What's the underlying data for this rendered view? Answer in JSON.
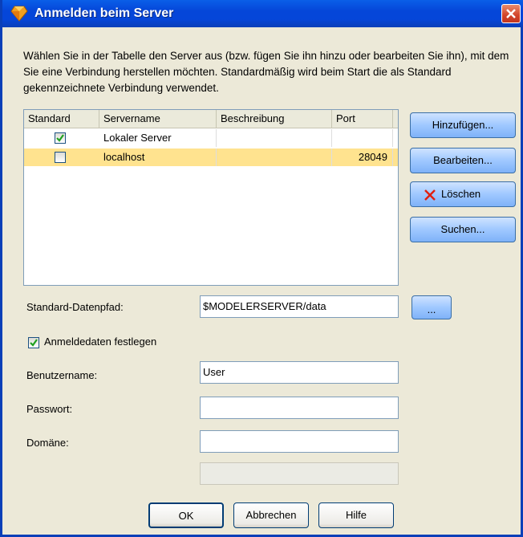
{
  "window": {
    "title": "Anmelden beim Server",
    "close_icon": "close-icon",
    "app_icon": "diamond-logo-icon"
  },
  "description": "Wählen Sie in der Tabelle den Server aus (bzw. fügen Sie ihn hinzu oder bearbeiten Sie ihn), mit dem Sie eine Verbindung herstellen möchten. Standardmäßig wird beim Start die als Standard gekennzeichnete Verbindung verwendet.",
  "table": {
    "columns": [
      "Standard",
      "Servername",
      "Beschreibung",
      "Port"
    ],
    "rows": [
      {
        "standard": true,
        "servername": "Lokaler Server",
        "beschreibung": "",
        "port": ""
      },
      {
        "standard": false,
        "servername": "localhost",
        "beschreibung": "",
        "port": "28049"
      }
    ]
  },
  "side_buttons": {
    "add": "Hinzufügen...",
    "edit": "Bearbeiten...",
    "delete": "Löschen",
    "search": "Suchen..."
  },
  "form": {
    "datapath_label": "Standard-Datenpfad:",
    "datapath_value": "$MODELERSERVER/data",
    "browse_label": "...",
    "credentials_label": "Anmeldedaten festlegen",
    "credentials_checked": true,
    "username_label": "Benutzername:",
    "username_value": "User",
    "password_label": "Passwort:",
    "password_value": "",
    "domain_label": "Domäne:",
    "domain_value": "",
    "extra_value": ""
  },
  "footer": {
    "ok": "OK",
    "cancel": "Abbrechen",
    "help": "Hilfe"
  },
  "colors": {
    "titlebar": "#0546d9",
    "selected_row": "#ffe38f",
    "dialog_bg": "#ece9d8"
  }
}
